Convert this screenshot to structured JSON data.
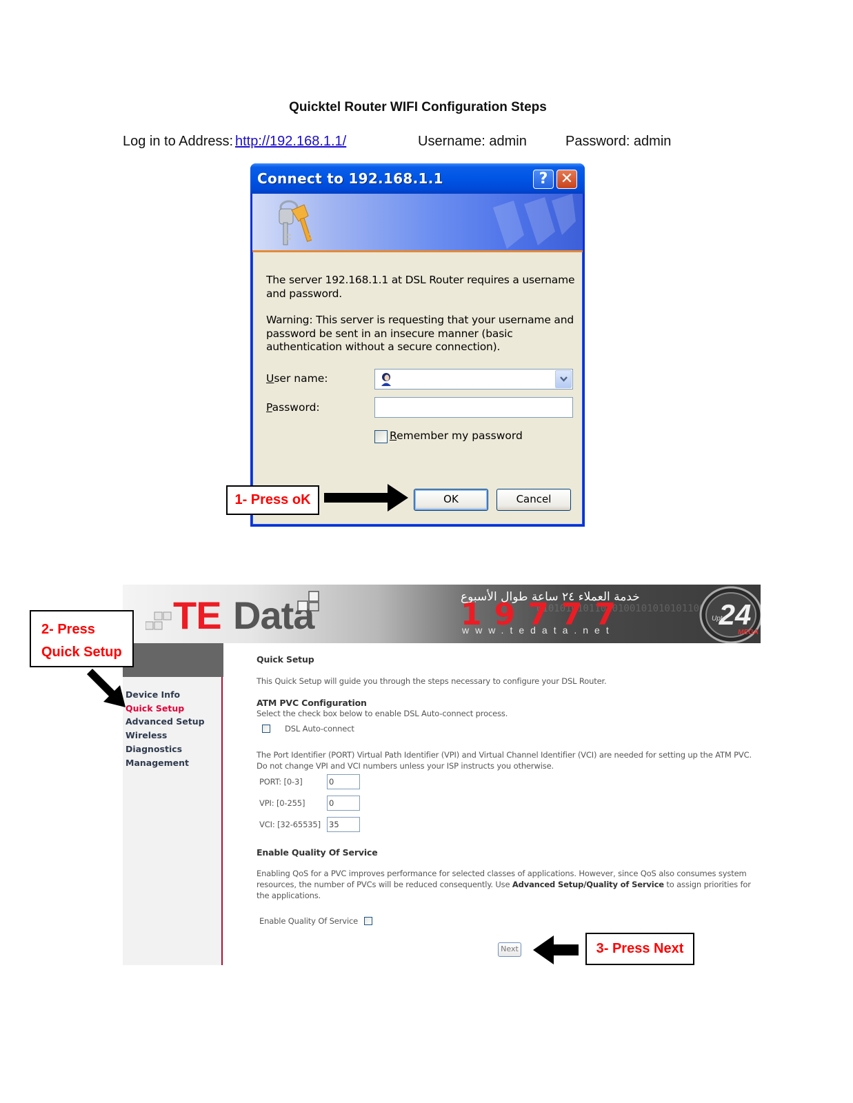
{
  "document": {
    "title": "Quicktel Router WIFI Configuration Steps",
    "login_label": "Log in to Address:",
    "login_url": "http://192.168.1.1/",
    "username_line": "Username: admin",
    "password_line": "Password: admin"
  },
  "dialog": {
    "title": "Connect to 192.168.1.1",
    "help_glyph": "?",
    "close_glyph": "✕",
    "icon": "keys-icon",
    "message": "The server 192.168.1.1 at DSL Router requires a username and password.",
    "warning": "Warning: This server is requesting that your username and password be sent in an insecure manner (basic authentication without a secure connection).",
    "username_label_accel": "U",
    "username_label_rest": "ser name:",
    "username_value": "",
    "password_label_accel": "P",
    "password_label_rest": "assword:",
    "password_value": "",
    "remember_accel": "R",
    "remember_rest": "emember my password",
    "remember_checked": false,
    "ok_label": "OK",
    "cancel_label": "Cancel"
  },
  "callouts": {
    "step1": "1- Press oK",
    "step2_line1": "2- Press",
    "step2_line2": "Quick Setup",
    "step3": "3- Press Next",
    "text_color": "#ff0000"
  },
  "router": {
    "brand_te": "TE",
    "brand_data": "Data",
    "arabic_tagline": "خدمة العملاء ٢٤ ساعة طوال الأسبوع",
    "hotline": "19777",
    "website": "www.tedata.net",
    "badge_top": "Upto",
    "badge_num": "24",
    "badge_bottom": "MEGA",
    "binary_pattern": "010101010110101001010101011001 0101011101010110101011101010010",
    "nav": [
      {
        "label": "Device Info",
        "active": false
      },
      {
        "label": "Quick Setup",
        "active": true
      },
      {
        "label": "Advanced Setup",
        "active": false
      },
      {
        "label": "Wireless",
        "active": false
      },
      {
        "label": "Diagnostics",
        "active": false
      },
      {
        "label": "Management",
        "active": false
      }
    ],
    "content": {
      "page_title": "Quick Setup",
      "intro": "This Quick Setup will guide you through the steps necessary to configure your DSL Router.",
      "atm_heading": "ATM PVC Configuration",
      "atm_desc": "Select the check box below to enable DSL Auto-connect process.",
      "auto_connect_label": "DSL Auto-connect",
      "auto_connect_checked": false,
      "pvc_desc_line1": "The Port Identifier (PORT) Virtual Path Identifier (VPI) and Virtual Channel Identifier (VCI) are needed for setting up the ATM PVC.",
      "pvc_desc_line2": "Do not change VPI and VCI numbers unless your ISP instructs you otherwise.",
      "fields": [
        {
          "label": "PORT: [0-3]",
          "value": "0"
        },
        {
          "label": "VPI: [0-255]",
          "value": "0"
        },
        {
          "label": "VCI: [32-65535]",
          "value": "35"
        }
      ],
      "qos_heading": "Enable Quality Of Service",
      "qos_desc_line1": "Enabling QoS for a PVC improves performance for selected classes of applications. However, since QoS also consumes system",
      "qos_desc_line2_a": "resources, the number of PVCs will be reduced consequently. Use ",
      "qos_desc_line2_bold": "Advanced Setup/Quality of Service",
      "qos_desc_line2_b": " to assign priorities for",
      "qos_desc_line3": "the applications.",
      "qos_checkbox_label": "Enable Quality Of Service",
      "qos_checked": false,
      "next_label": "Next"
    }
  }
}
